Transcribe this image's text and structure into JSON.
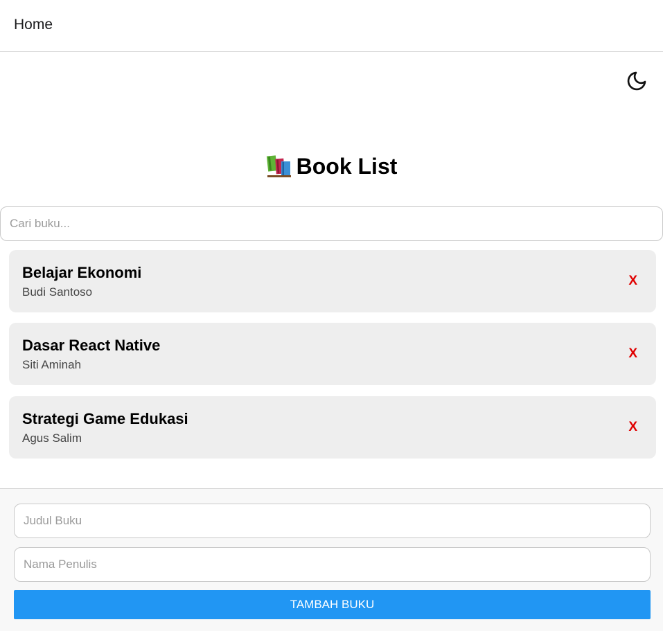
{
  "header": {
    "title": "Home"
  },
  "theme_toggle": {
    "icon": "moon-icon"
  },
  "page": {
    "title_icon": "books-icon",
    "title": "Book List"
  },
  "search": {
    "placeholder": "Cari buku...",
    "value": ""
  },
  "books": [
    {
      "title": "Belajar Ekonomi",
      "author": "Budi Santoso",
      "delete_label": "X"
    },
    {
      "title": "Dasar React Native",
      "author": "Siti Aminah",
      "delete_label": "X"
    },
    {
      "title": "Strategi Game Edukasi",
      "author": "Agus Salim",
      "delete_label": "X"
    }
  ],
  "form": {
    "title_placeholder": "Judul Buku",
    "author_placeholder": "Nama Penulis",
    "submit_label": "TAMBAH BUKU"
  },
  "colors": {
    "accent": "#2196f3",
    "delete": "#e00000",
    "card_bg": "#eeeeee"
  }
}
